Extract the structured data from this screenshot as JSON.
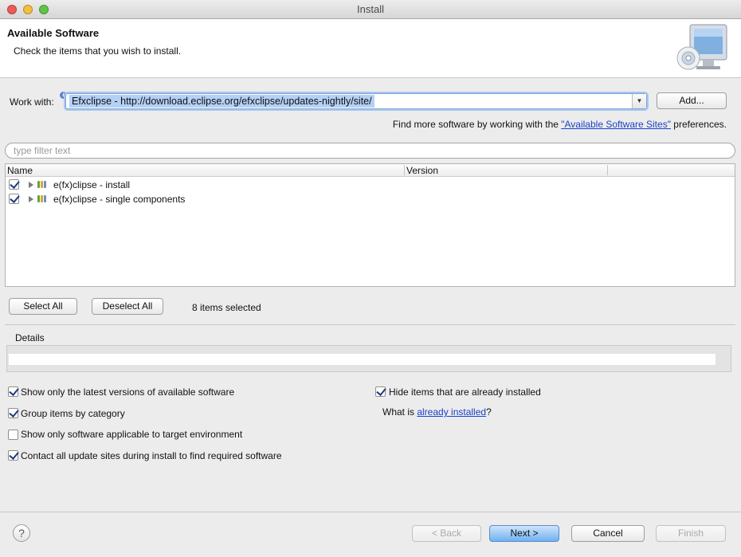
{
  "window": {
    "title": "Install",
    "traffic_lights": {
      "close": "#ee5b54",
      "minimize": "#f5be3b",
      "zoom": "#61c447"
    }
  },
  "header": {
    "title": "Available Software",
    "subtitle": "Check the items that you wish to install.",
    "icon": "monitor-cd-icon"
  },
  "work_with": {
    "label": "Work with:",
    "value": "Efxclipse - http://download.eclipse.org/efxclipse/updates-nightly/site/",
    "add_label": "Add..."
  },
  "more_software": {
    "prefix": "Find more software by working with the ",
    "link": "\"Available Software Sites\"",
    "suffix": " preferences."
  },
  "filter": {
    "placeholder": "type filter text",
    "value": ""
  },
  "table": {
    "columns": [
      "Name",
      "Version"
    ],
    "rows": [
      {
        "name": "e(fx)clipse - install",
        "version": "",
        "checked": true
      },
      {
        "name": "e(fx)clipse - single components",
        "version": "",
        "checked": true
      }
    ]
  },
  "selection": {
    "select_all": "Select All",
    "deselect_all": "Deselect All",
    "status": "8 items selected"
  },
  "details": {
    "label": "Details"
  },
  "options": {
    "left": [
      {
        "label": "Show only the latest versions of available software",
        "checked": true
      },
      {
        "label": "Group items by category",
        "checked": true
      },
      {
        "label": "Show only software applicable to target environment",
        "checked": false
      },
      {
        "label": "Contact all update sites during install to find required software",
        "checked": true
      }
    ],
    "hide_installed": {
      "label": "Hide items that are already installed",
      "checked": true
    },
    "what_is": {
      "prefix": "What is ",
      "link": "already installed",
      "suffix": "?"
    }
  },
  "footer": {
    "help": "?",
    "back": "< Back",
    "next": "Next >",
    "cancel": "Cancel",
    "finish": "Finish"
  }
}
